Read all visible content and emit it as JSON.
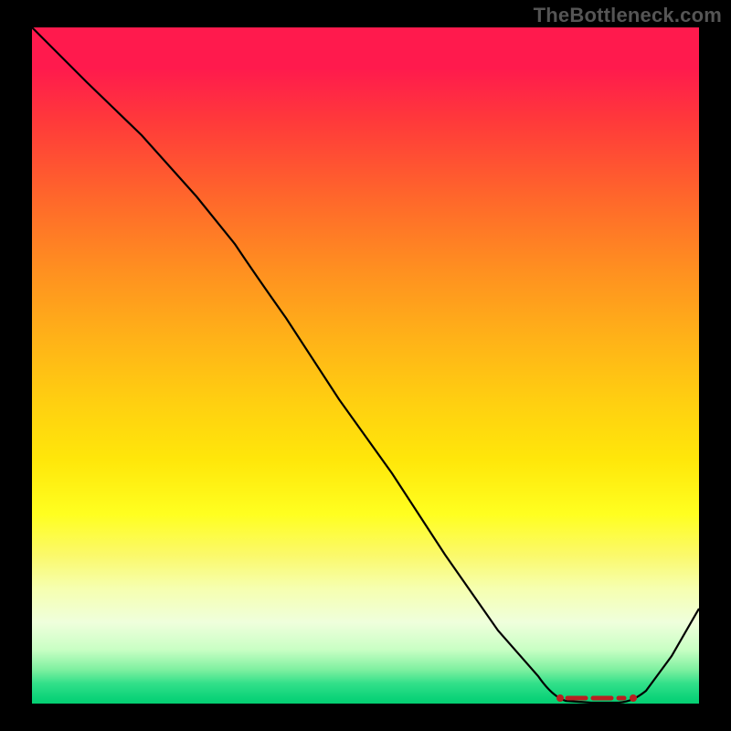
{
  "watermark": "TheBottleneck.com",
  "chart_data": {
    "type": "line",
    "title": "",
    "xlabel": "",
    "ylabel": "",
    "xlim": [
      0,
      100
    ],
    "ylim": [
      0,
      100
    ],
    "series": [
      {
        "name": "curve",
        "x": [
          0,
          8,
          16,
          24,
          30,
          38,
          46,
          54,
          62,
          70,
          76,
          80,
          84,
          88,
          92,
          96,
          100
        ],
        "y": [
          100,
          92,
          84,
          75,
          68,
          57,
          45,
          34,
          22,
          11,
          4,
          1,
          0,
          0,
          2,
          7,
          14
        ]
      }
    ],
    "markers": {
      "name": "optimal-range",
      "x_start": 80,
      "x_end": 92,
      "y": 0.5
    },
    "gradient_bands": [
      {
        "stop": 0,
        "color": "#ff1a4d"
      },
      {
        "stop": 50,
        "color": "#ffc814"
      },
      {
        "stop": 78,
        "color": "#fff85a"
      },
      {
        "stop": 92,
        "color": "#d6ffc8"
      },
      {
        "stop": 100,
        "color": "#04cf72"
      }
    ]
  }
}
